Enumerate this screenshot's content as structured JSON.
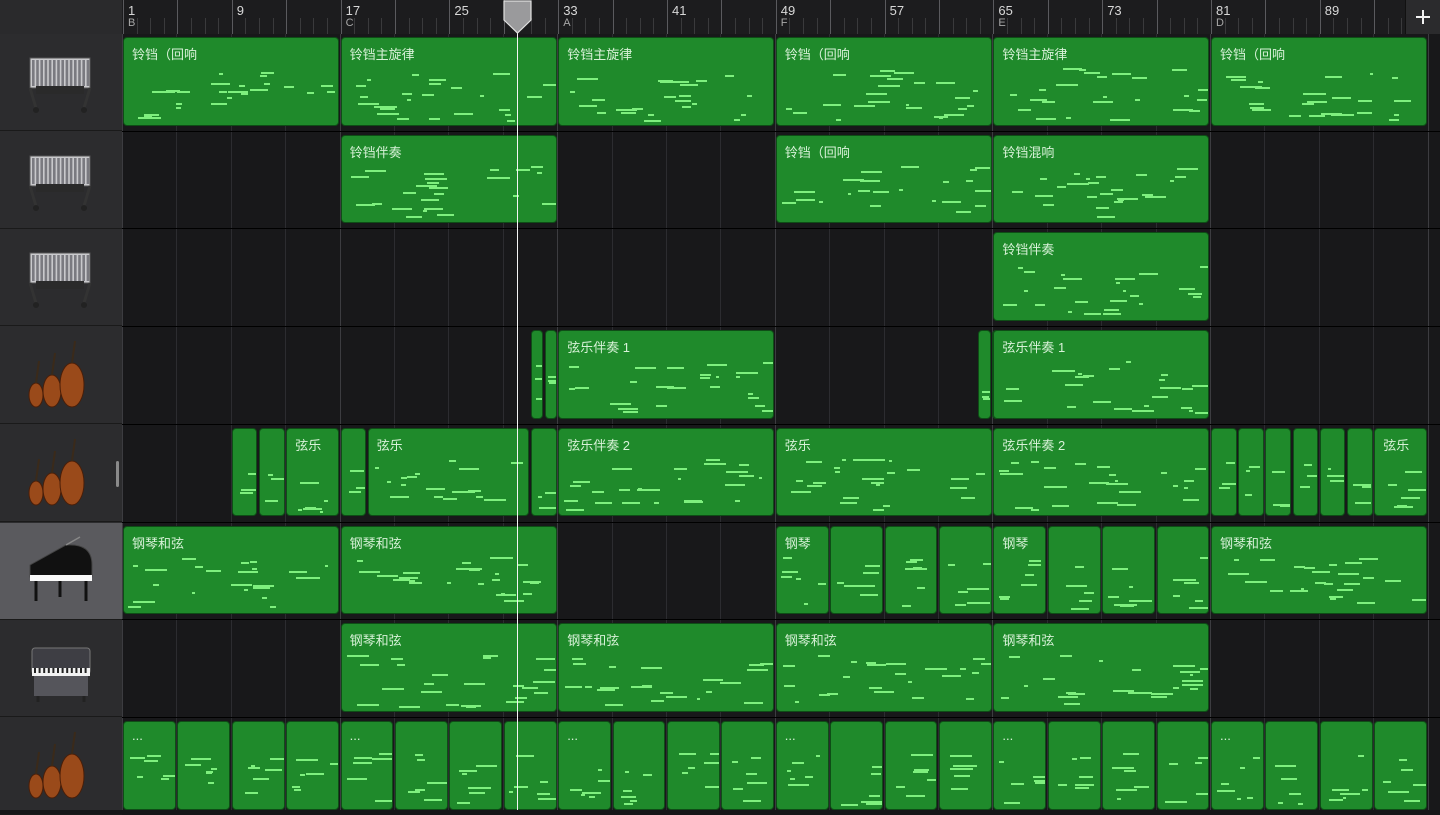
{
  "ruler": {
    "bars": [
      {
        "num": "1",
        "section": "B"
      },
      {
        "num": "",
        "section": ""
      },
      {
        "num": "9",
        "section": ""
      },
      {
        "num": "",
        "section": ""
      },
      {
        "num": "17",
        "section": "C"
      },
      {
        "num": "",
        "section": ""
      },
      {
        "num": "25",
        "section": ""
      },
      {
        "num": "",
        "section": ""
      },
      {
        "num": "33",
        "section": "A"
      },
      {
        "num": "",
        "section": ""
      },
      {
        "num": "41",
        "section": ""
      },
      {
        "num": "",
        "section": ""
      },
      {
        "num": "49",
        "section": "F"
      },
      {
        "num": "",
        "section": ""
      },
      {
        "num": "57",
        "section": ""
      },
      {
        "num": "",
        "section": ""
      },
      {
        "num": "65",
        "section": "E"
      },
      {
        "num": "",
        "section": ""
      },
      {
        "num": "73",
        "section": ""
      },
      {
        "num": "",
        "section": ""
      },
      {
        "num": "81",
        "section": "D"
      },
      {
        "num": "",
        "section": ""
      },
      {
        "num": "89",
        "section": ""
      },
      {
        "num": "",
        "section": ""
      }
    ]
  },
  "tracks": [
    {
      "instrument": "vibraphone-icon",
      "selected": false,
      "regions": [
        {
          "name": "铃铛（回响",
          "start": 0,
          "bars": 16
        },
        {
          "name": "铃铛主旋律",
          "start": 16,
          "bars": 16
        },
        {
          "name": "铃铛主旋律",
          "start": 32,
          "bars": 16
        },
        {
          "name": "铃铛（回响",
          "start": 48,
          "bars": 16
        },
        {
          "name": "铃铛主旋律",
          "start": 64,
          "bars": 16
        },
        {
          "name": "铃铛（回响",
          "start": 80,
          "bars": 16
        }
      ]
    },
    {
      "instrument": "vibraphone-icon",
      "selected": false,
      "regions": [
        {
          "name": "铃铛伴奏",
          "start": 16,
          "bars": 16
        },
        {
          "name": "铃铛（回响",
          "start": 48,
          "bars": 16
        },
        {
          "name": "铃铛混响",
          "start": 64,
          "bars": 16
        }
      ]
    },
    {
      "instrument": "vibraphone-icon",
      "selected": false,
      "regions": [
        {
          "name": "铃铛伴奏",
          "start": 64,
          "bars": 16
        }
      ]
    },
    {
      "instrument": "strings-icon",
      "selected": false,
      "regions": [
        {
          "name": "",
          "start": 30,
          "bars": 1
        },
        {
          "name": "",
          "start": 31,
          "bars": 1
        },
        {
          "name": "弦乐伴奏 1",
          "start": 32,
          "bars": 16
        },
        {
          "name": "",
          "start": 62.9,
          "bars": 1
        },
        {
          "name": "",
          "start": 63.9,
          "bars": 1
        },
        {
          "name": "弦乐伴奏 1",
          "start": 64,
          "bars": 16
        }
      ]
    },
    {
      "instrument": "strings-icon",
      "selected": false,
      "regions": [
        {
          "name": "",
          "start": 8,
          "bars": 2
        },
        {
          "name": "",
          "start": 10,
          "bars": 2
        },
        {
          "name": "弦乐",
          "start": 12,
          "bars": 4
        },
        {
          "name": "",
          "start": 16,
          "bars": 2
        },
        {
          "name": "弦乐",
          "start": 18,
          "bars": 12
        },
        {
          "name": "",
          "start": 30,
          "bars": 2
        },
        {
          "name": "弦乐伴奏 2",
          "start": 32,
          "bars": 16
        },
        {
          "name": "弦乐",
          "start": 48,
          "bars": 16
        },
        {
          "name": "弦乐伴奏 2",
          "start": 64,
          "bars": 16
        },
        {
          "name": "",
          "start": 80,
          "bars": 2
        },
        {
          "name": "",
          "start": 82,
          "bars": 2
        },
        {
          "name": "",
          "start": 84,
          "bars": 2
        },
        {
          "name": "",
          "start": 86,
          "bars": 2
        },
        {
          "name": "",
          "start": 88,
          "bars": 2
        },
        {
          "name": "",
          "start": 90,
          "bars": 2
        },
        {
          "name": "弦乐",
          "start": 92,
          "bars": 4
        }
      ]
    },
    {
      "instrument": "grand-piano-icon",
      "selected": true,
      "regions": [
        {
          "name": "钢琴和弦",
          "start": 0,
          "bars": 16
        },
        {
          "name": "钢琴和弦",
          "start": 16,
          "bars": 16
        },
        {
          "name": "钢琴",
          "start": 48,
          "bars": 4
        },
        {
          "name": "",
          "start": 52,
          "bars": 4
        },
        {
          "name": "",
          "start": 56,
          "bars": 4
        },
        {
          "name": "",
          "start": 60,
          "bars": 4
        },
        {
          "name": "钢琴",
          "start": 64,
          "bars": 4
        },
        {
          "name": "",
          "start": 68,
          "bars": 4
        },
        {
          "name": "",
          "start": 72,
          "bars": 4
        },
        {
          "name": "",
          "start": 76,
          "bars": 4
        },
        {
          "name": "钢琴和弦",
          "start": 80,
          "bars": 16
        }
      ]
    },
    {
      "instrument": "electric-piano-icon",
      "selected": false,
      "regions": [
        {
          "name": "钢琴和弦",
          "start": 16,
          "bars": 16
        },
        {
          "name": "钢琴和弦",
          "start": 32,
          "bars": 16
        },
        {
          "name": "钢琴和弦",
          "start": 48,
          "bars": 16
        },
        {
          "name": "钢琴和弦",
          "start": 64,
          "bars": 16
        }
      ]
    },
    {
      "instrument": "strings-icon",
      "selected": false,
      "regions": [
        {
          "name": "...",
          "start": 0,
          "bars": 4
        },
        {
          "name": "",
          "start": 4,
          "bars": 4
        },
        {
          "name": "",
          "start": 8,
          "bars": 4
        },
        {
          "name": "",
          "start": 12,
          "bars": 4
        },
        {
          "name": "...",
          "start": 16,
          "bars": 4
        },
        {
          "name": "",
          "start": 20,
          "bars": 4
        },
        {
          "name": "",
          "start": 24,
          "bars": 4
        },
        {
          "name": "",
          "start": 28,
          "bars": 4
        },
        {
          "name": "...",
          "start": 32,
          "bars": 4
        },
        {
          "name": "",
          "start": 36,
          "bars": 4
        },
        {
          "name": "",
          "start": 40,
          "bars": 4
        },
        {
          "name": "",
          "start": 44,
          "bars": 4
        },
        {
          "name": "...",
          "start": 48,
          "bars": 4
        },
        {
          "name": "",
          "start": 52,
          "bars": 4
        },
        {
          "name": "",
          "start": 56,
          "bars": 4
        },
        {
          "name": "",
          "start": 60,
          "bars": 4
        },
        {
          "name": "...",
          "start": 64,
          "bars": 4
        },
        {
          "name": "",
          "start": 68,
          "bars": 4
        },
        {
          "name": "",
          "start": 72,
          "bars": 4
        },
        {
          "name": "",
          "start": 76,
          "bars": 4
        },
        {
          "name": "...",
          "start": 80,
          "bars": 4
        },
        {
          "name": "",
          "start": 84,
          "bars": 4
        },
        {
          "name": "",
          "start": 88,
          "bars": 4
        },
        {
          "name": "",
          "start": 92,
          "bars": 4
        }
      ]
    }
  ],
  "playhead": {
    "bar": 28.9
  },
  "colors": {
    "region": "#1f8a2b",
    "note": "#7ef07e",
    "selected_track": "#5a5a5e"
  }
}
